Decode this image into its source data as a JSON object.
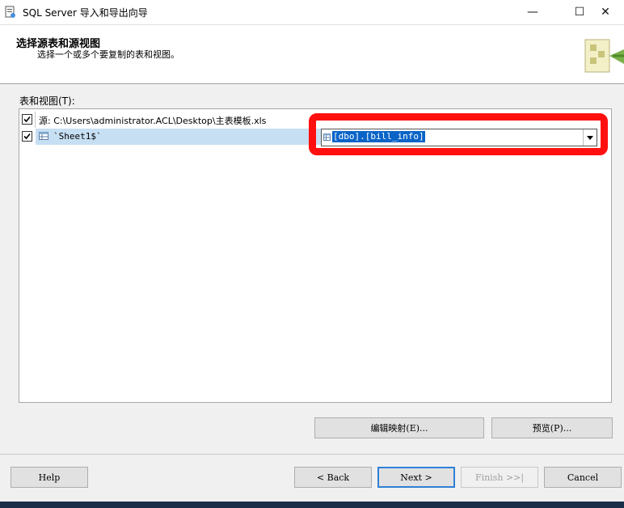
{
  "window": {
    "title": "SQL Server 导入和导出向导",
    "minimize_glyph": "—",
    "maximize_glyph": "☐",
    "close_glyph": "✕"
  },
  "header": {
    "title": "选择源表和源视图",
    "subtitle": "选择一个或多个要复制的表和视图。",
    "logo_icon": "wizard-logo-icon"
  },
  "tables": {
    "label": "表和视图(T):",
    "source_row": {
      "checked": true,
      "text": "源: C:\\Users\\administrator.ACL\\Desktop\\主表模板.xls"
    },
    "rows": [
      {
        "checked": true,
        "source": "`Sheet1$`",
        "destination": "[dbo].[bill_info]"
      }
    ]
  },
  "buttons": {
    "edit_mapping": "编辑映射(E)...",
    "preview": "预览(P)...",
    "help": "Help",
    "back": "< Back",
    "next": "Next >",
    "finish": "Finish >>|",
    "cancel": "Cancel"
  },
  "colors": {
    "highlight": "#ff1010",
    "selection": "#0a64c8",
    "selected_row": "#c7dff3"
  }
}
